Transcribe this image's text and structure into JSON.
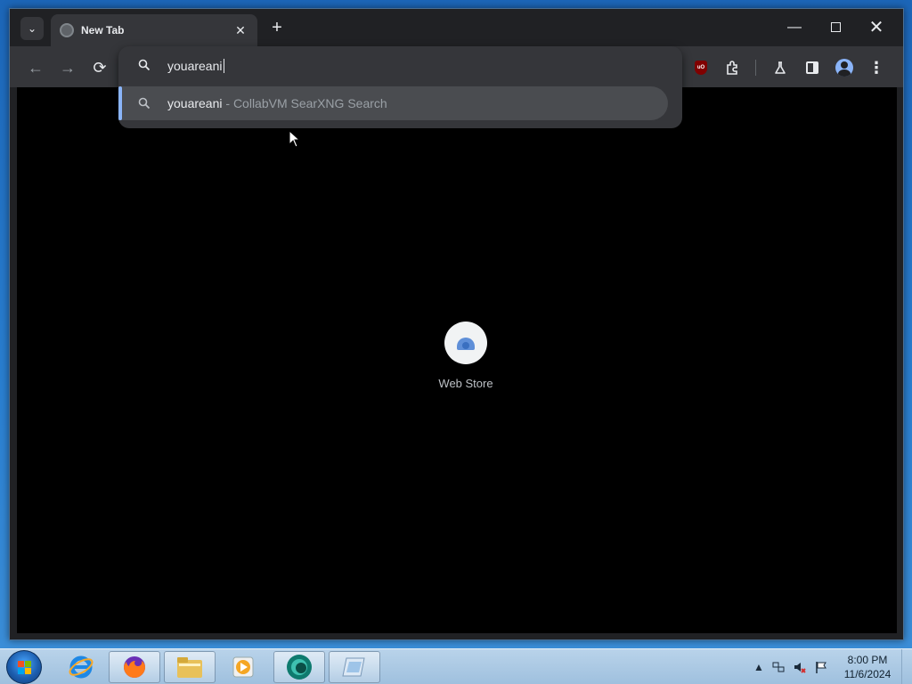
{
  "browser": {
    "tab": {
      "title": "New Tab",
      "close_label": "✕"
    },
    "new_tab_label": "+",
    "window_controls": {
      "minimize": "—",
      "close": "✕"
    },
    "nav": {
      "back": "←",
      "forward": "→",
      "reload": "⟳"
    },
    "extensions": {
      "ublock_label": "uO",
      "menu_label": "⋮"
    }
  },
  "omnibox": {
    "input_value": "youareani",
    "suggestion": {
      "query": "youareani",
      "engine": " - CollabVM SearXNG Search"
    }
  },
  "page": {
    "shortcuts": [
      {
        "label": "Web Store",
        "icon": "web-store-icon"
      }
    ]
  },
  "taskbar": {
    "items": [
      {
        "name": "internet-explorer",
        "icon": "ie-icon"
      },
      {
        "name": "firefox",
        "icon": "firefox-icon"
      },
      {
        "name": "file-explorer",
        "icon": "folder-icon"
      },
      {
        "name": "media-player",
        "icon": "media-player-icon"
      },
      {
        "name": "chrome-canary",
        "icon": "browser-icon"
      },
      {
        "name": "paint",
        "icon": "paint-icon"
      }
    ],
    "clock": {
      "time": "8:00 PM",
      "date": "11/6/2024"
    }
  },
  "colors": {
    "accent": "#8ab4f8",
    "toolbar": "#35363a",
    "tabstrip": "#202124",
    "page_bg": "#000000"
  }
}
